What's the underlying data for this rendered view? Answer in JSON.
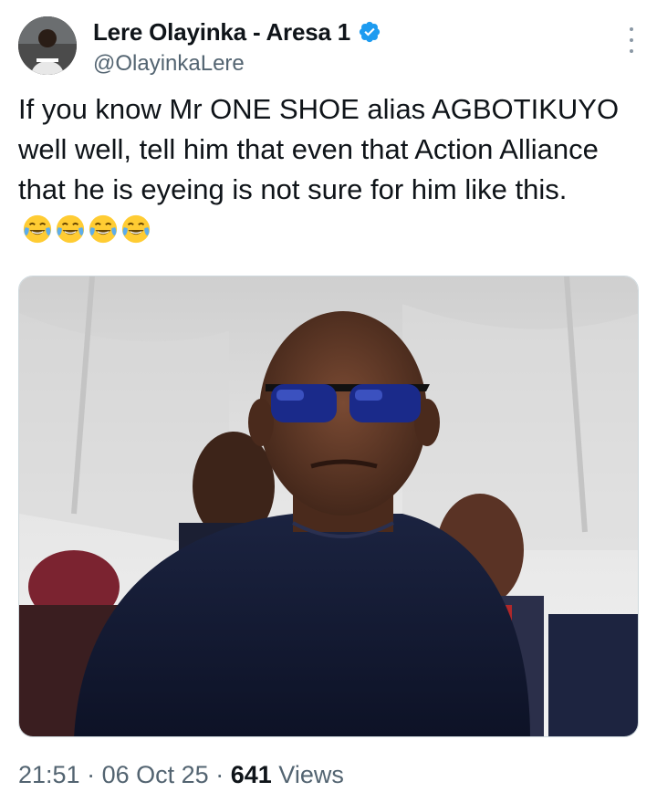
{
  "author": {
    "display_name": "Lere Olayinka - Aresa 1",
    "handle": "@OlayinkaLere",
    "verified": true
  },
  "tweet": {
    "text": "If you know Mr ONE SHOE alias AGBOTIKUYO well well, tell him that even that Action Alliance that he is eyeing is not sure for him like this.",
    "emojis": [
      "😂",
      "😂",
      "😂",
      "😂"
    ]
  },
  "meta": {
    "time": "21:51",
    "separator": "·",
    "date": "06 Oct 25",
    "views_count": "641",
    "views_label": "Views"
  },
  "icons": {
    "verified": "verified-badge-icon",
    "more": "more-options-icon",
    "emoji": "face-with-tears-of-joy-icon"
  },
  "colors": {
    "verified_blue": "#1d9bf0",
    "text_primary": "#0f1419",
    "text_secondary": "#536471"
  }
}
